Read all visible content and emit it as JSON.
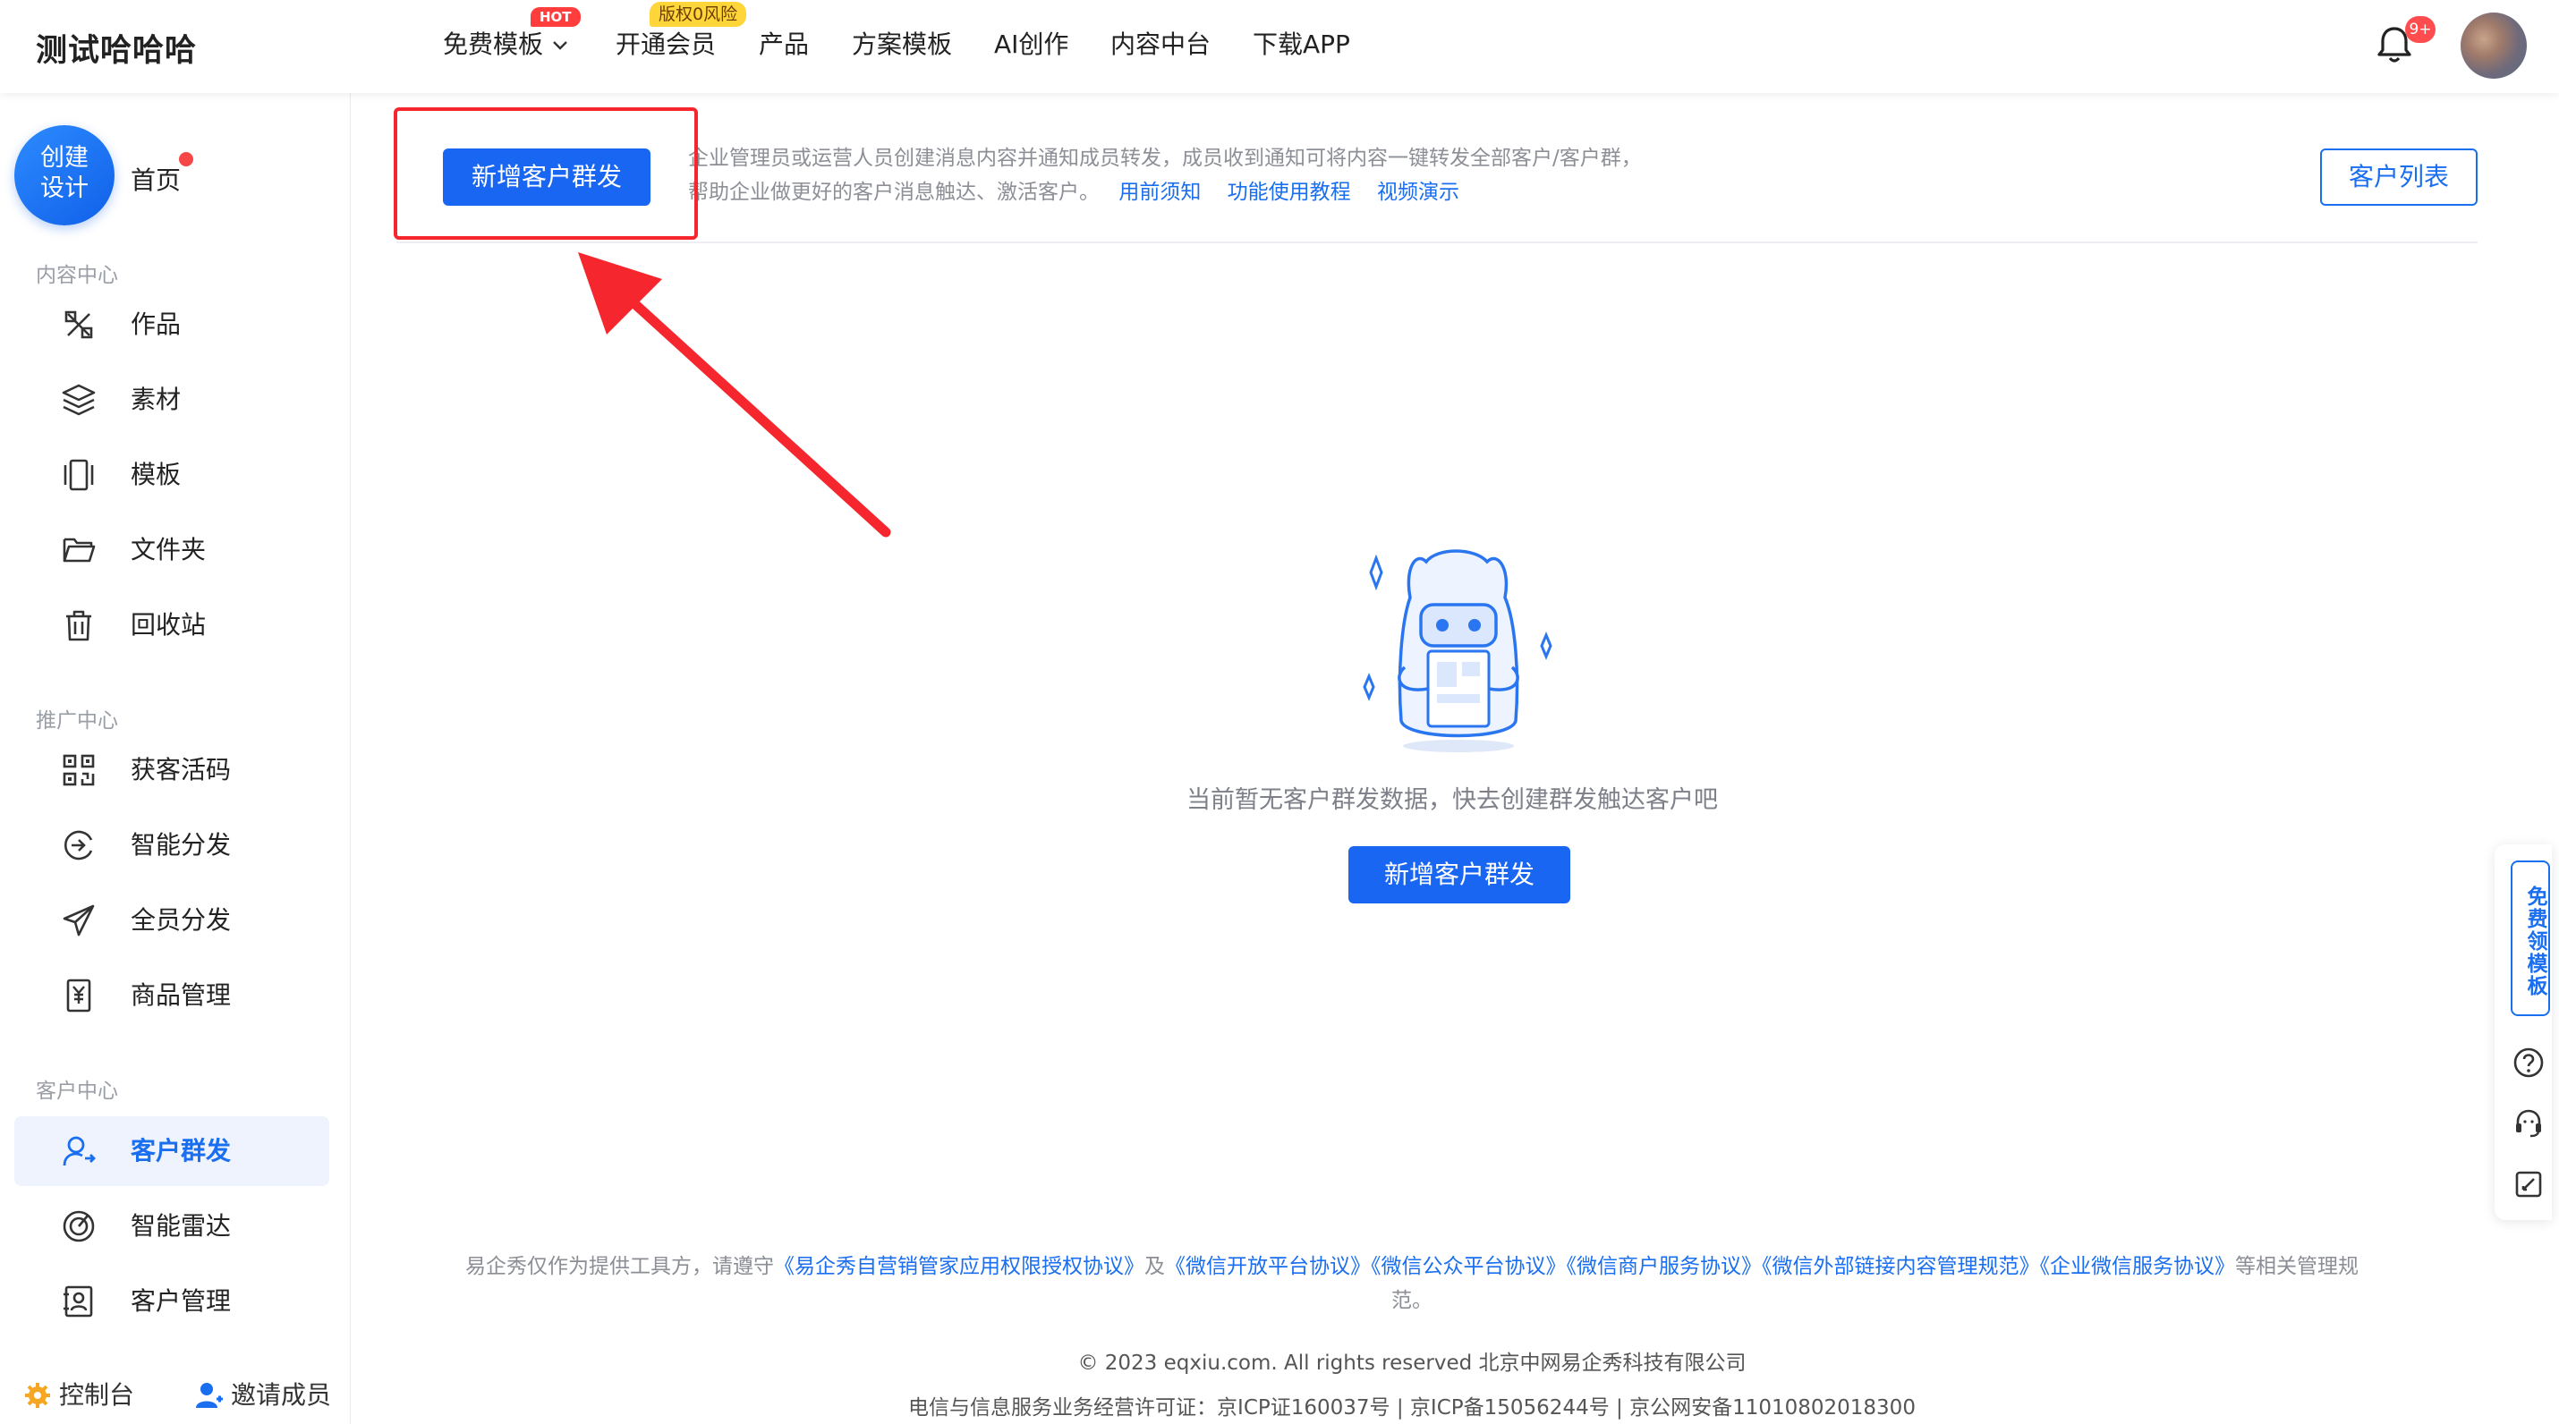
{
  "header": {
    "brand": "测试哈哈哈",
    "nav": [
      {
        "label": "免费模板",
        "badge": "HOT",
        "has_caret": true
      },
      {
        "label": "开通会员",
        "badge": "版权0风险"
      },
      {
        "label": "产品"
      },
      {
        "label": "方案模板"
      },
      {
        "label": "AI创作"
      },
      {
        "label": "内容中台"
      },
      {
        "label": "下载APP"
      }
    ],
    "notification_count": "9+",
    "bell_icon": "bell-icon"
  },
  "sidebar": {
    "create_button": "创建\n设计",
    "home": "首页",
    "sections": [
      {
        "title": "内容中心",
        "items": [
          {
            "label": "作品",
            "icon": "tools-icon"
          },
          {
            "label": "素材",
            "icon": "layers-icon"
          },
          {
            "label": "模板",
            "icon": "template-icon"
          },
          {
            "label": "文件夹",
            "icon": "folder-icon"
          },
          {
            "label": "回收站",
            "icon": "trash-icon"
          }
        ]
      },
      {
        "title": "推广中心",
        "items": [
          {
            "label": "获客活码",
            "icon": "qrcode-icon"
          },
          {
            "label": "智能分发",
            "icon": "distribute-icon"
          },
          {
            "label": "全员分发",
            "icon": "send-icon"
          },
          {
            "label": "商品管理",
            "icon": "goods-icon"
          }
        ]
      },
      {
        "title": "客户中心",
        "items": [
          {
            "label": "客户群发",
            "icon": "user-broadcast-icon",
            "active": true
          },
          {
            "label": "智能雷达",
            "icon": "radar-icon"
          },
          {
            "label": "客户管理",
            "icon": "contacts-icon"
          }
        ]
      }
    ],
    "bottom": {
      "console": "控制台",
      "invite": "邀请成员"
    }
  },
  "main": {
    "new_button": "新增客户群发",
    "description_line1": "企业管理员或运营人员创建消息内容并通知成员转发，成员收到通知可将内容一键转发全部客户/客户群，",
    "description_line2": "帮助企业做更好的客户消息触达、激活客户。",
    "links": [
      "用前须知",
      "功能使用教程",
      "视频演示"
    ],
    "customer_list_button": "客户列表",
    "empty_text": "当前暂无客户群发数据，快去创建群发触达客户吧",
    "empty_button": "新增客户群发"
  },
  "footer": {
    "prefix": "易企秀仅作为提供工具方，请遵守",
    "agreements": [
      "《易企秀自营销管家应用权限授权协议》",
      "《微信开放平台协议》",
      "《微信公众平台协议》",
      "《微信商户服务协议》",
      "《微信外部链接内容管理规范》",
      "《企业微信服务协议》"
    ],
    "joiner": "及",
    "suffix": "等相关管理规",
    "suffix2": "范。",
    "copyright": "© 2023 eqxiu.com. All rights reserved 北京中网易企秀科技有限公司",
    "license": "电信与信息服务业务经营许可证：京ICP证160037号 | 京ICP备15056244号 | 京公网安备11010802018300"
  },
  "float_bar": {
    "free_template": "免费领模板",
    "icons": [
      "help-icon",
      "customer-service-icon",
      "feedback-icon"
    ]
  },
  "colors": {
    "primary": "#1966f3",
    "annotation": "#f5262d",
    "badge_red": "#ff4d4f",
    "badge_yellow": "#ffd63a"
  }
}
